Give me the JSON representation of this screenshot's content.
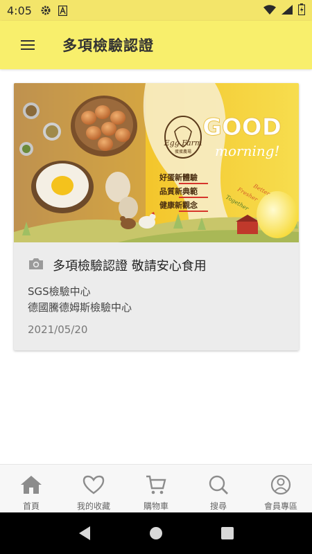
{
  "status_bar": {
    "time": "4:05",
    "icons": [
      "settings-gear-icon",
      "android-a-icon",
      "wifi-icon",
      "signal-icon",
      "battery-charging-icon"
    ]
  },
  "app_bar": {
    "title": "多項檢驗認證",
    "menu_icon": "hamburger-menu-icon"
  },
  "card": {
    "banner": {
      "brand": "Egg Farm",
      "brand_sub": "蛋蛋農場",
      "headline_word": "GOOD",
      "headline_sub": "morning!",
      "slogans": [
        "好蛋新體驗",
        "品質新典範",
        "健康新觀念"
      ],
      "tags": [
        "Better",
        "Fresher",
        "Together"
      ]
    },
    "camera_icon": "camera-icon",
    "title": "多項檢驗認證 敬請安心食用",
    "lines": [
      "SGS檢驗中心",
      "德國騰德姆斯檢驗中心"
    ],
    "date": "2021/05/20"
  },
  "bottom_nav": {
    "items": [
      {
        "label": "首頁",
        "icon": "home-icon"
      },
      {
        "label": "我的收藏",
        "icon": "heart-icon"
      },
      {
        "label": "購物車",
        "icon": "cart-icon"
      },
      {
        "label": "搜尋",
        "icon": "search-icon"
      },
      {
        "label": "會員專區",
        "icon": "user-icon"
      }
    ]
  },
  "system_nav": {
    "buttons": [
      "back-icon",
      "home-circle-icon",
      "recents-icon"
    ]
  },
  "colors": {
    "accent_yellow": "#f8ef6c",
    "status_yellow": "#f3e56a",
    "card_bg": "#ececec"
  }
}
